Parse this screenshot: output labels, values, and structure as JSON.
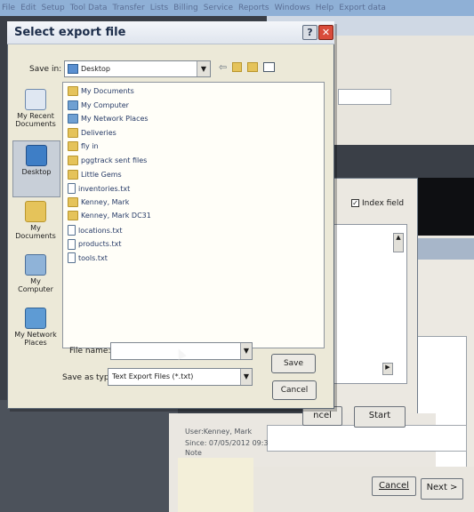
{
  "app_menu": [
    "File",
    "Edit",
    "Setup",
    "Tool Data",
    "Transfer",
    "Lists",
    "Billing",
    "Service",
    "Reports",
    "Windows",
    "Help",
    "Export data"
  ],
  "dialog": {
    "title": "Select export file",
    "help_glyph": "?",
    "close_glyph": "✕",
    "save_in_label": "Save in:",
    "save_in_value": "Desktop",
    "places": [
      {
        "label": "My Recent Documents",
        "icon": "recent-documents-icon"
      },
      {
        "label": "Desktop",
        "icon": "desktop-icon"
      },
      {
        "label": "My Documents",
        "icon": "my-documents-icon"
      },
      {
        "label": "My Computer",
        "icon": "my-computer-icon"
      },
      {
        "label": "My Network Places",
        "icon": "network-places-icon"
      }
    ],
    "files": [
      {
        "name": "My Documents",
        "icon": "folder"
      },
      {
        "name": "My Computer",
        "icon": "sys"
      },
      {
        "name": "My Network Places",
        "icon": "sys"
      },
      {
        "name": "Deliveries",
        "icon": "folder"
      },
      {
        "name": "fly in",
        "icon": "folder"
      },
      {
        "name": "pggtrack sent files",
        "icon": "folder"
      },
      {
        "name": "Little Gems",
        "icon": "folder"
      },
      {
        "name": "inventories.txt",
        "icon": "doc"
      },
      {
        "name": "Kenney, Mark",
        "icon": "folder"
      },
      {
        "name": "Kenney, Mark DC31",
        "icon": "folder"
      },
      {
        "name": "locations.txt",
        "icon": "doc"
      },
      {
        "name": "products.txt",
        "icon": "doc"
      },
      {
        "name": "tools.txt",
        "icon": "doc"
      }
    ],
    "file_name_label": "File name:",
    "file_name_value": "",
    "save_as_type_label": "Save as type:",
    "save_as_type_value": "Text Export Files (*.txt)",
    "save_button": "Save",
    "cancel_button": "Cancel"
  },
  "background": {
    "index_field_label": "Index field",
    "cancel_partial": "ncel",
    "start_button": "Start",
    "user_line": "User:Kenney, Mark",
    "since_line": "Since: 07/05/2012 09:3",
    "note_label": "Note",
    "cancel_button": "Cancel",
    "next_button": "Next >"
  },
  "colors": {
    "close_button": "#d94b3a",
    "title_text": "#1c2d4a",
    "folder": "#e5c35a"
  }
}
